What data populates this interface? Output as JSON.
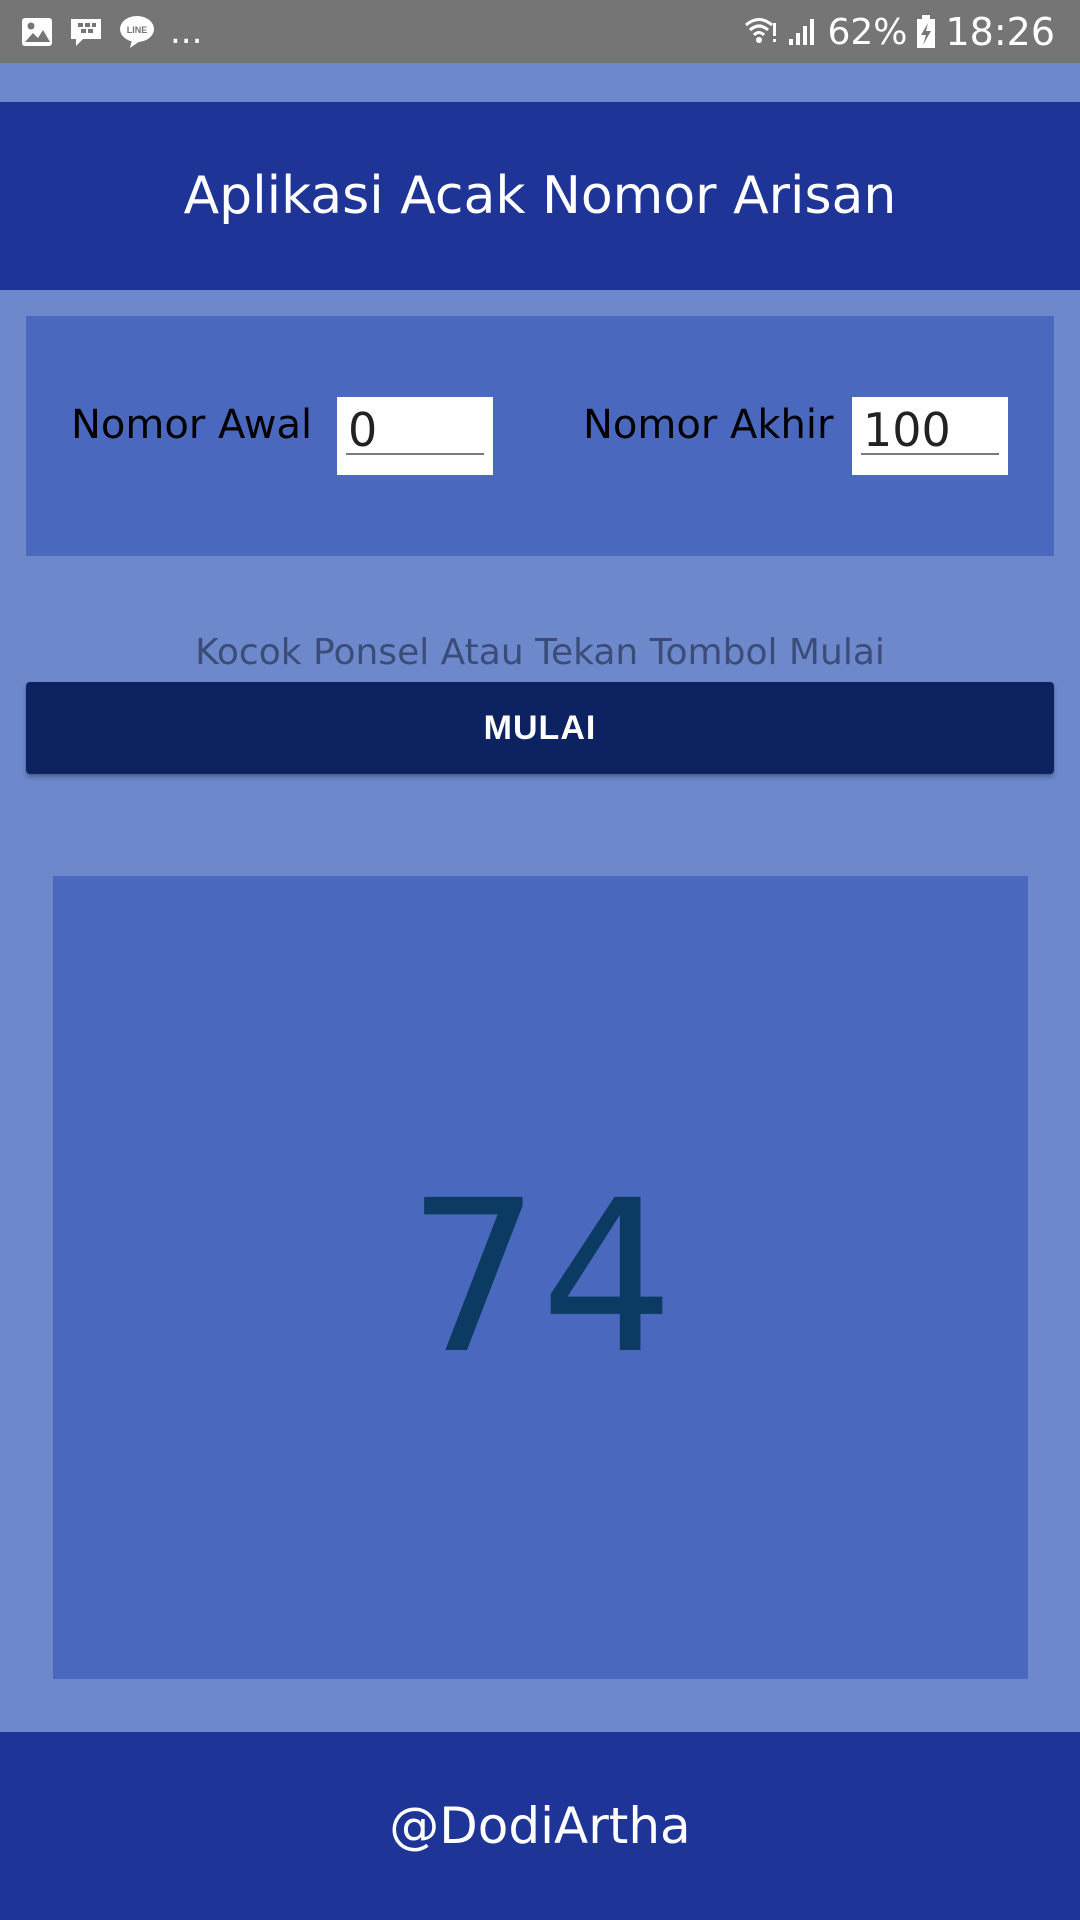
{
  "status_bar": {
    "left_icons": [
      "image-icon",
      "bbm-icon",
      "line-icon"
    ],
    "overflow": "...",
    "battery_percent": "62%",
    "time": "18:26"
  },
  "header": {
    "title": "Aplikasi Acak Nomor Arisan"
  },
  "range": {
    "start_label": "Nomor Awal",
    "start_value": "0",
    "end_label": "Nomor Akhir",
    "end_value": "100"
  },
  "hint": "Kocok Ponsel Atau Tekan Tombol Mulai",
  "start_button_label": "MULAI",
  "result": "74",
  "footer": {
    "credit": "@DodiArtha"
  },
  "colors": {
    "background": "#6d89cc",
    "header": "#1e3597",
    "panel": "#4a69be",
    "button": "#0d2260",
    "result_text": "#0b3b62",
    "status_bar": "#757575"
  }
}
